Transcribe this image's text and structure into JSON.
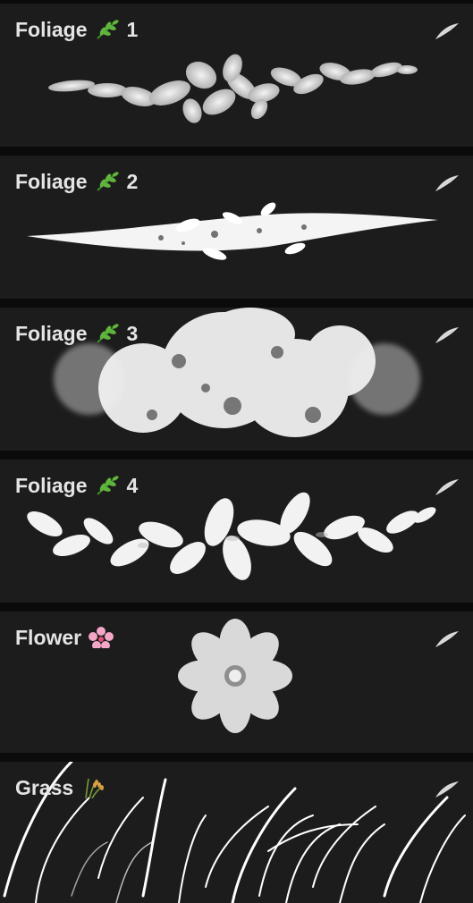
{
  "brushes": [
    {
      "name": "Foliage",
      "emoji": "herb-icon",
      "num": "1"
    },
    {
      "name": "Foliage",
      "emoji": "herb-icon",
      "num": "2"
    },
    {
      "name": "Foliage",
      "emoji": "herb-icon",
      "num": "3"
    },
    {
      "name": "Foliage",
      "emoji": "herb-icon",
      "num": "4"
    },
    {
      "name": "Flower",
      "emoji": "cherry-blossom-icon",
      "num": ""
    },
    {
      "name": "Grass",
      "emoji": "rice-sheaf-icon",
      "num": ""
    }
  ],
  "colors": {
    "background": "#0b0b0b",
    "panel": "#1c1c1c",
    "title": "#e4e4e4",
    "stroke": "#ffffff"
  }
}
